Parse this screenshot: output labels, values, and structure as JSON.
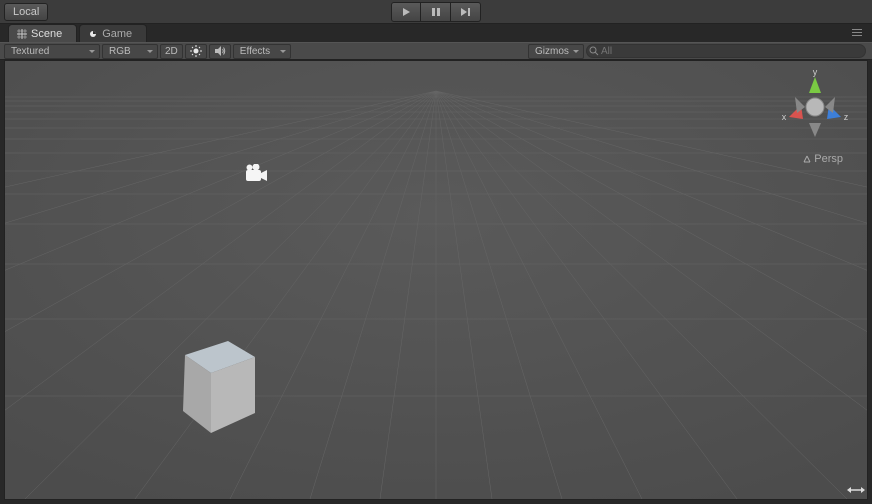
{
  "topbar": {
    "pivot_mode": "Local"
  },
  "tabs": {
    "scene": "Scene",
    "game": "Game"
  },
  "toolbar": {
    "draw_mode": "Textured",
    "render_mode": "RGB",
    "view_2d": "2D",
    "effects": "Effects",
    "gizmos": "Gizmos"
  },
  "search": {
    "placeholder": "All"
  },
  "viewport": {
    "projection": "Persp",
    "axes": {
      "x": "x",
      "y": "y",
      "z": "z"
    }
  }
}
